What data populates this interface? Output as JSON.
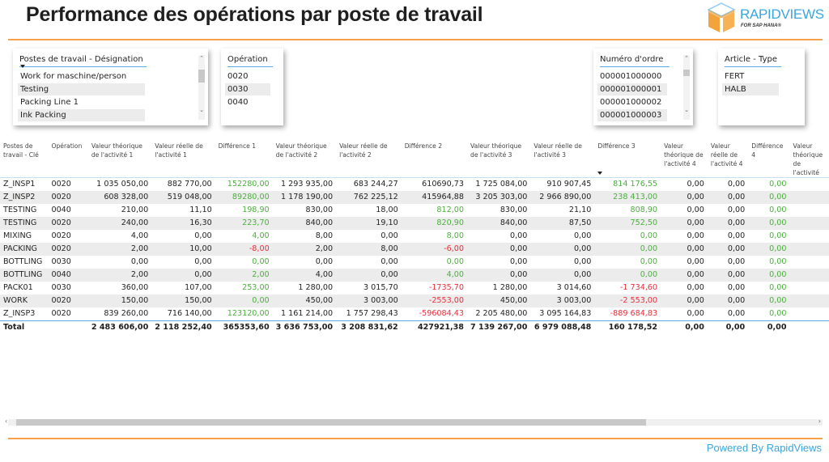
{
  "header": {
    "title": "Performance des opérations par poste de travail",
    "logo_text": "RAPIDVIEWS",
    "logo_subtext": "FOR SAP HANA®",
    "brand_color": "#3aa6dd",
    "accent_color": "#f7a04b"
  },
  "slicers": {
    "workcenter": {
      "label": "Postes de travail - Désignation",
      "items": [
        "Work for maschine/person",
        "Testing",
        "Packing Line 1",
        "Ink Packing"
      ]
    },
    "operation": {
      "label": "Opération",
      "items": [
        "0020",
        "0030",
        "0040"
      ]
    },
    "order": {
      "label": "Numéro d'ordre",
      "items": [
        "000001000000",
        "000001000001",
        "000001000002",
        "000001000003"
      ]
    },
    "article": {
      "label": "Article - Type",
      "items": [
        "FERT",
        "HALB"
      ]
    }
  },
  "table": {
    "columns": [
      "Postes de travail - Clé",
      "Opération",
      "Valeur théorique de l'activité 1",
      "Valeur réelle de l'activité 1",
      "Différence 1",
      "Valeur théorique de l'activité 2",
      "Valeur réelle de l'activité 2",
      "Différence 2",
      "Valeur théorique de l'activité 3",
      "Valeur réelle de l'activité 3",
      "Différence 3",
      "Valeur théorique de l'activité 4",
      "Valeur réelle de l'activité 4",
      "Différence 4",
      "Valeur théorique de l'activité"
    ],
    "sorted_column": "Différence 3",
    "rows": [
      [
        "Z_INSP1",
        "0020",
        "1 035 050,00",
        "882 770,00",
        "152280,00",
        "1 293 935,00",
        "683 244,27",
        "610690,73",
        "1 725 084,00",
        "910 907,45",
        "814 176,55",
        "0,00",
        "0,00",
        "0,00",
        ""
      ],
      [
        "Z_INSP2",
        "0020",
        "608 328,00",
        "519 048,00",
        "89280,00",
        "1 178 190,00",
        "762 225,12",
        "415964,88",
        "3 205 303,00",
        "2 966 890,00",
        "238 413,00",
        "0,00",
        "0,00",
        "0,00",
        ""
      ],
      [
        "TESTING",
        "0040",
        "210,00",
        "11,10",
        "198,90",
        "830,00",
        "18,00",
        "812,00",
        "830,00",
        "21,10",
        "808,90",
        "0,00",
        "0,00",
        "0,00",
        ""
      ],
      [
        "TESTING",
        "0020",
        "240,00",
        "16,30",
        "223,70",
        "840,00",
        "19,10",
        "820,90",
        "840,00",
        "87,50",
        "752,50",
        "0,00",
        "0,00",
        "0,00",
        ""
      ],
      [
        "MIXING",
        "0020",
        "4,00",
        "0,00",
        "4,00",
        "8,00",
        "0,00",
        "8,00",
        "0,00",
        "0,00",
        "0,00",
        "0,00",
        "0,00",
        "0,00",
        ""
      ],
      [
        "PACKING",
        "0020",
        "2,00",
        "10,00",
        "-8,00",
        "2,00",
        "8,00",
        "-6,00",
        "0,00",
        "0,00",
        "0,00",
        "0,00",
        "0,00",
        "0,00",
        ""
      ],
      [
        "BOTTLING",
        "0030",
        "0,00",
        "0,00",
        "0,00",
        "0,00",
        "0,00",
        "0,00",
        "0,00",
        "0,00",
        "0,00",
        "0,00",
        "0,00",
        "0,00",
        ""
      ],
      [
        "BOTTLING",
        "0040",
        "2,00",
        "0,00",
        "2,00",
        "4,00",
        "0,00",
        "4,00",
        "0,00",
        "0,00",
        "0,00",
        "0,00",
        "0,00",
        "0,00",
        ""
      ],
      [
        "PACK01",
        "0030",
        "360,00",
        "107,00",
        "253,00",
        "1 280,00",
        "3 015,70",
        "-1735,70",
        "1 280,00",
        "3 014,60",
        "-1 734,60",
        "0,00",
        "0,00",
        "0,00",
        ""
      ],
      [
        "WORK",
        "0020",
        "150,00",
        "150,00",
        "0,00",
        "450,00",
        "3 003,00",
        "-2553,00",
        "450,00",
        "3 003,00",
        "-2 553,00",
        "0,00",
        "0,00",
        "0,00",
        ""
      ],
      [
        "Z_INSP3",
        "0020",
        "839 260,00",
        "716 140,00",
        "123120,00",
        "1 161 214,00",
        "1 757 298,43",
        "-596084,43",
        "2 205 480,00",
        "3 095 164,83",
        "-889 684,83",
        "0,00",
        "0,00",
        "0,00",
        ""
      ]
    ],
    "cell_status": [
      [
        "",
        "",
        "",
        "",
        "pos",
        "",
        "",
        "",
        "",
        "",
        "pos",
        "",
        "",
        "pos",
        ""
      ],
      [
        "",
        "",
        "",
        "",
        "pos",
        "",
        "",
        "",
        "",
        "",
        "pos",
        "",
        "",
        "pos",
        ""
      ],
      [
        "",
        "",
        "",
        "",
        "pos",
        "",
        "",
        "pos",
        "",
        "",
        "pos",
        "",
        "",
        "pos",
        ""
      ],
      [
        "",
        "",
        "",
        "",
        "pos",
        "",
        "",
        "pos",
        "",
        "",
        "pos",
        "",
        "",
        "pos",
        ""
      ],
      [
        "",
        "",
        "",
        "",
        "pos",
        "",
        "",
        "pos",
        "",
        "",
        "pos",
        "",
        "",
        "pos",
        ""
      ],
      [
        "",
        "",
        "",
        "",
        "neg",
        "",
        "",
        "neg",
        "",
        "",
        "pos",
        "",
        "",
        "pos",
        ""
      ],
      [
        "",
        "",
        "",
        "",
        "pos",
        "",
        "",
        "pos",
        "",
        "",
        "pos",
        "",
        "",
        "pos",
        ""
      ],
      [
        "",
        "",
        "",
        "",
        "pos",
        "",
        "",
        "pos",
        "",
        "",
        "pos",
        "",
        "",
        "pos",
        ""
      ],
      [
        "",
        "",
        "",
        "",
        "pos",
        "",
        "",
        "neg",
        "",
        "",
        "neg",
        "",
        "",
        "pos",
        ""
      ],
      [
        "",
        "",
        "",
        "",
        "pos",
        "",
        "",
        "neg",
        "",
        "",
        "neg",
        "",
        "",
        "pos",
        ""
      ],
      [
        "",
        "",
        "",
        "",
        "pos",
        "",
        "",
        "neg",
        "",
        "",
        "neg",
        "",
        "",
        "pos",
        ""
      ]
    ],
    "total": [
      "Total",
      "",
      "2 483 606,00",
      "2 118 252,40",
      "365353,60",
      "3 636 753,00",
      "3 208 831,62",
      "427921,38",
      "7 139 267,00",
      "6 979 088,48",
      "160 178,52",
      "0,00",
      "0,00",
      "0,00",
      ""
    ],
    "status_colors": {
      "pos": "#4caf3e",
      "neg": "#e8303b"
    }
  },
  "footer": {
    "powered_by": "Powered By RapidViews"
  }
}
